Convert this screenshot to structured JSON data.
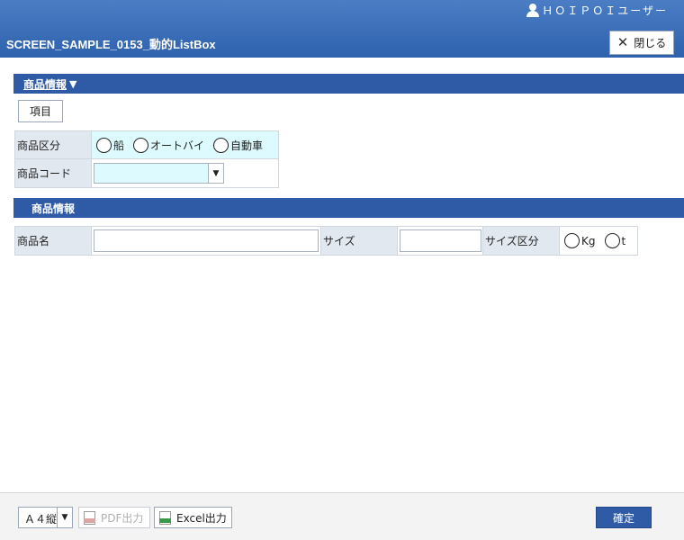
{
  "header": {
    "user_name": "ＨＯＩＰＯＩユーザー",
    "title": "SCREEN_SAMPLE_0153_動的ListBox",
    "close_label": "閉じる"
  },
  "section1": {
    "title": "商品情報",
    "toggle_icon": "triangle-down",
    "item_button_label": "項目",
    "product_category_label": "商品区分",
    "product_category_options": [
      "船",
      "オートバイ",
      "自動車"
    ],
    "product_code_label": "商品コード",
    "product_code_value": ""
  },
  "section2": {
    "title": "商品情報",
    "product_name_label": "商品名",
    "product_name_value": "",
    "size_label": "サイズ",
    "size_value": "",
    "size_unit_label": "サイズ区分",
    "size_unit_options": [
      "Kg",
      "t"
    ]
  },
  "footer": {
    "paper_size": "Ａ４縦",
    "pdf_label": "PDF出力",
    "excel_label": "Excel出力",
    "confirm_label": "確定"
  },
  "colors": {
    "header_top": "#4a7dc4",
    "header_bottom": "#2f62ad",
    "section_bar": "#2f5ba6",
    "label_cell": "#e2e8ef",
    "select_bg": "#ddfbff"
  }
}
